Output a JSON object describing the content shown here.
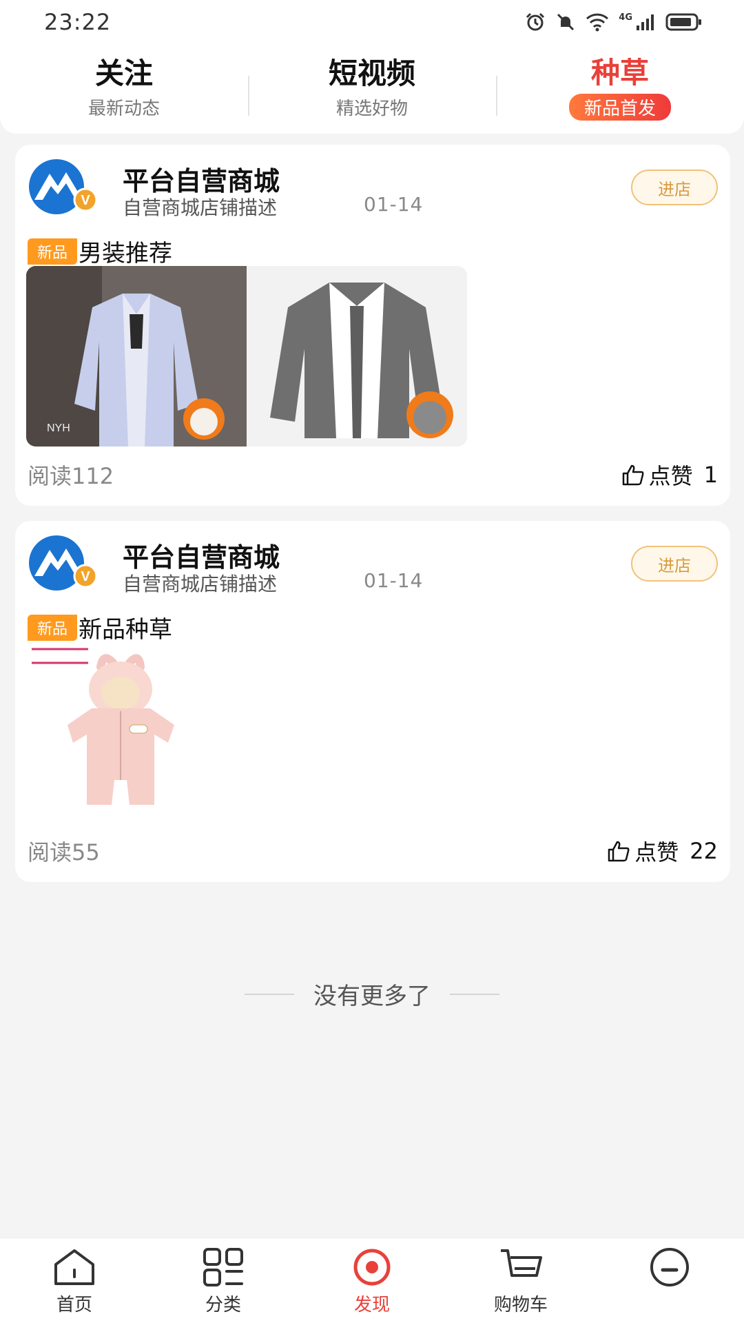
{
  "status_bar": {
    "time": "23:22",
    "network": "4G"
  },
  "tabs": [
    {
      "title": "关注",
      "subtitle": "最新动态"
    },
    {
      "title": "短视频",
      "subtitle": "精选好物"
    },
    {
      "title": "种草",
      "subtitle": "新品首发"
    }
  ],
  "accent_color": "#e8413a",
  "posts": [
    {
      "shop_name": "平台自营商城",
      "shop_desc": "自营商城店铺描述",
      "date": "01-14",
      "enter_label": "进店",
      "tag": "新品",
      "title": "男装推荐",
      "images": [
        "shirt-blue-image",
        "shirt-grey-image"
      ],
      "read_label": "阅读112",
      "like_label": "点赞",
      "like_count": "1"
    },
    {
      "shop_name": "平台自营商城",
      "shop_desc": "自营商城店铺描述",
      "date": "01-14",
      "enter_label": "进店",
      "tag": "新品",
      "title": "新品种草",
      "images": [
        "baby-romper-pink-image"
      ],
      "read_label": "阅读55",
      "like_label": "点赞",
      "like_count": "22"
    }
  ],
  "footer": {
    "no_more": "没有更多了"
  },
  "bottom_nav": [
    {
      "label": "首页",
      "icon": "home-icon"
    },
    {
      "label": "分类",
      "icon": "grid-icon"
    },
    {
      "label": "发现",
      "icon": "discover-icon"
    },
    {
      "label": "购物车",
      "icon": "cart-icon"
    },
    {
      "label": "",
      "icon": "profile-icon"
    }
  ]
}
